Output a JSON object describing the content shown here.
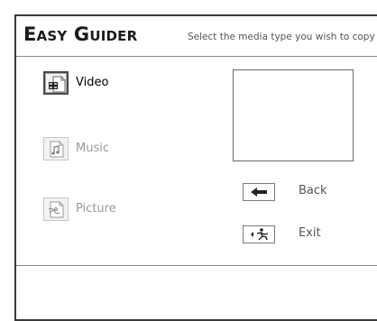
{
  "header": {
    "title": "Easy Guider",
    "instruction": "Select the media type you wish to copy"
  },
  "media_types": [
    {
      "label": "Video",
      "icon": "video-icon",
      "selected": true
    },
    {
      "label": "Music",
      "icon": "music-icon",
      "selected": false
    },
    {
      "label": "Picture",
      "icon": "picture-icon",
      "selected": false
    }
  ],
  "actions": {
    "back_label": "Back",
    "exit_label": "Exit"
  },
  "colors": {
    "border": "#3a3a3a",
    "selected_text": "#000000",
    "disabled_text": "#9a9a9a"
  }
}
